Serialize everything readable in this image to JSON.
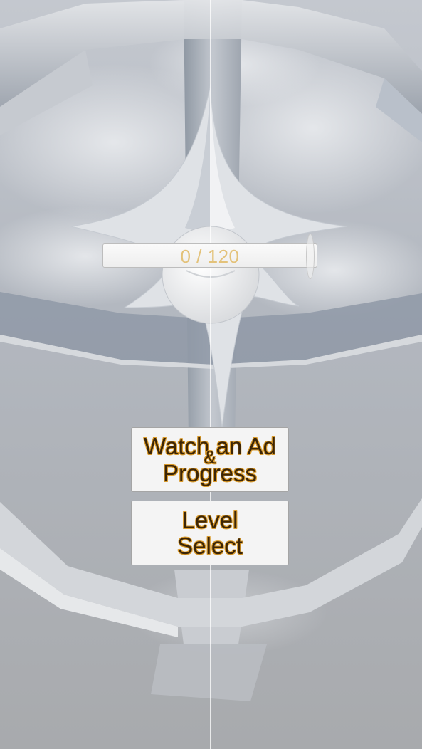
{
  "hud": {
    "progress_text": "0 / 120",
    "progress_fraction": 0
  },
  "buttons": {
    "watch_ad_line1": "Watch an Ad",
    "watch_ad_amp": "&",
    "watch_ad_line2": "Progress",
    "level_select_label": "Level\nSelect"
  },
  "colors": {
    "sky_top": "#b7bcc4",
    "sky_bottom": "#a9acaf",
    "structure": "#d7d9dc",
    "structure_shadow": "#8e96a2",
    "button_text": "#3b2507",
    "button_outline": "#d99a2b",
    "progress_text": "#e3c27a"
  }
}
